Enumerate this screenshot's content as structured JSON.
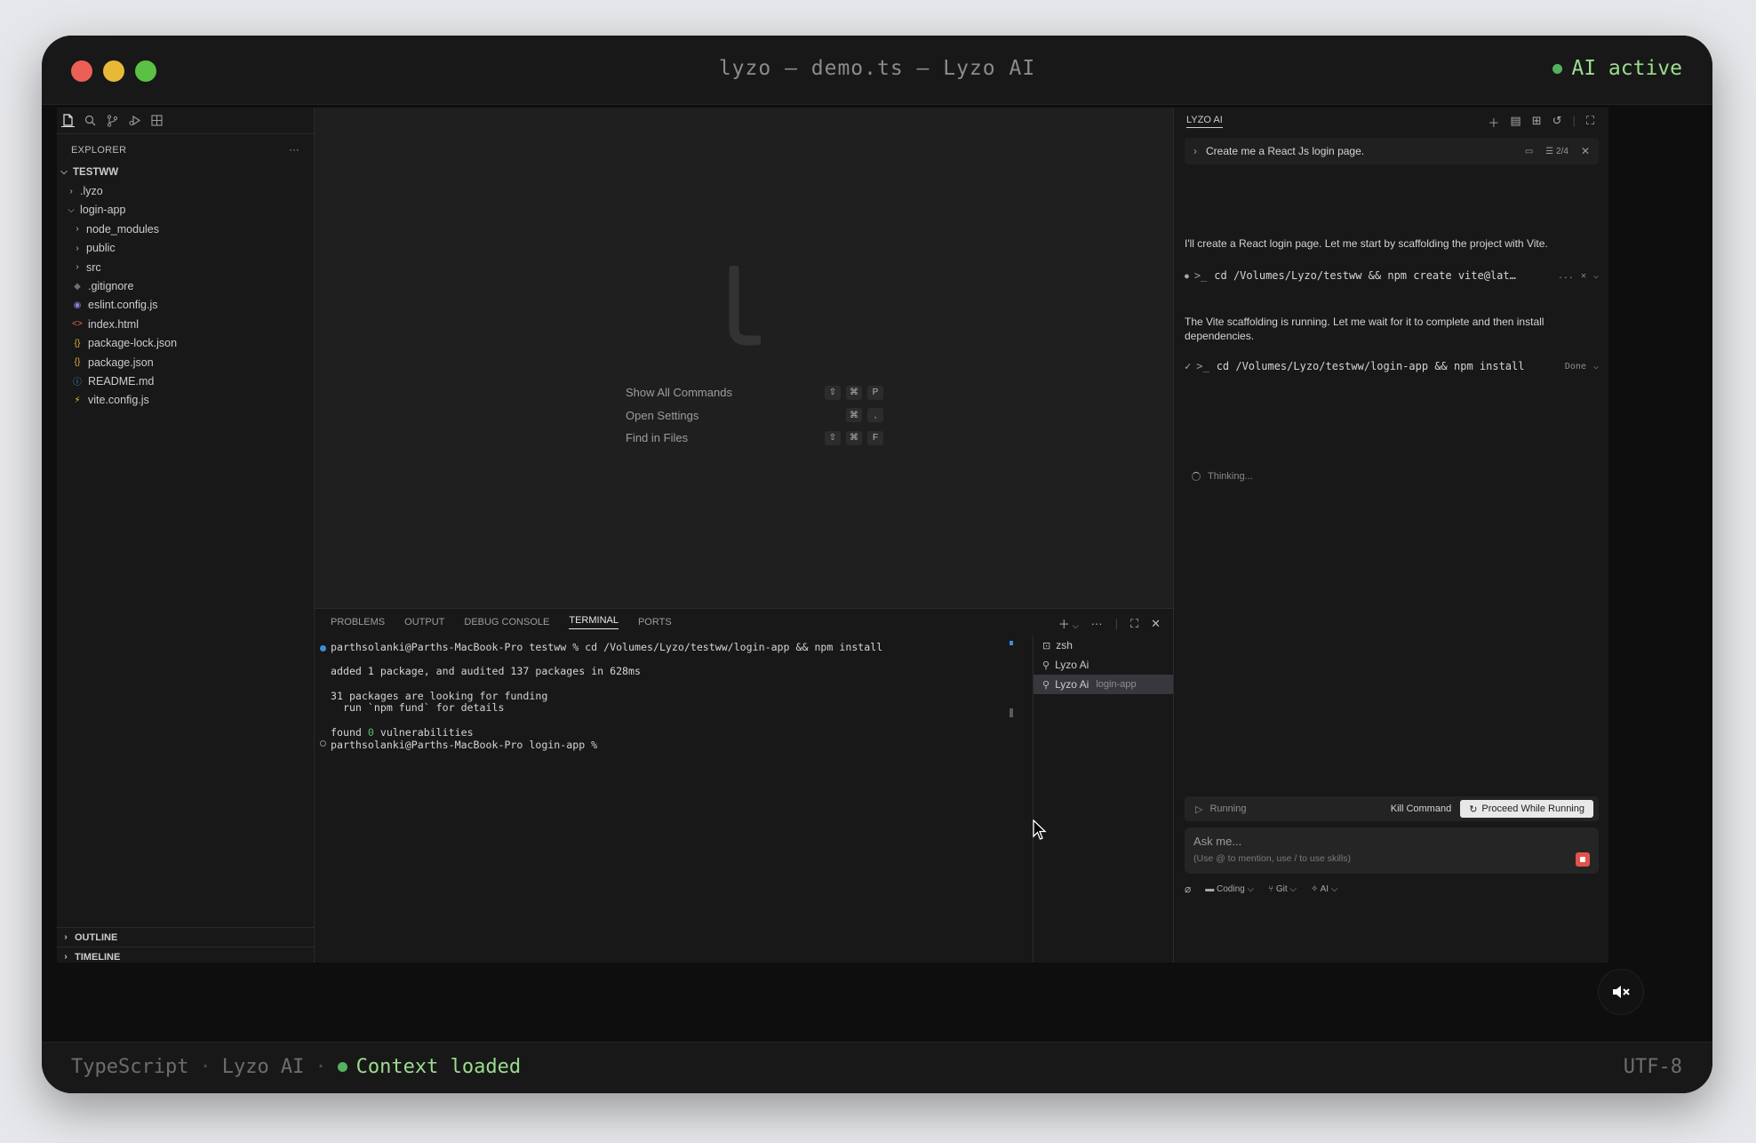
{
  "window": {
    "title": "lyzo — demo.ts — Lyzo AI",
    "ai_status": "AI active"
  },
  "status_bar": {
    "language": "TypeScript",
    "sep": "·",
    "app": "Lyzo AI",
    "context": "Context loaded",
    "encoding": "UTF-8"
  },
  "explorer": {
    "header": "EXPLORER",
    "more": "···",
    "root": "TESTWW",
    "items": [
      {
        "label": ".lyzo",
        "kind": "folder",
        "depth": 1,
        "open": false
      },
      {
        "label": "login-app",
        "kind": "folder",
        "depth": 1,
        "open": true
      },
      {
        "label": "node_modules",
        "kind": "folder",
        "depth": 2,
        "open": false
      },
      {
        "label": "public",
        "kind": "folder",
        "depth": 2,
        "open": false
      },
      {
        "label": "src",
        "kind": "folder",
        "depth": 2,
        "open": false
      },
      {
        "label": ".gitignore",
        "kind": "file",
        "depth": 2,
        "icon": "git-icon",
        "glyph": "◆",
        "color": "#6f6f6f"
      },
      {
        "label": "eslint.config.js",
        "kind": "file",
        "depth": 2,
        "icon": "eslint-icon",
        "glyph": "◉",
        "color": "#8f7ad6"
      },
      {
        "label": "index.html",
        "kind": "file",
        "depth": 2,
        "icon": "html-icon",
        "glyph": "<>",
        "color": "#e3733c"
      },
      {
        "label": "package-lock.json",
        "kind": "file",
        "depth": 2,
        "icon": "json-icon",
        "glyph": "{}",
        "color": "#d7b23d"
      },
      {
        "label": "package.json",
        "kind": "file",
        "depth": 2,
        "icon": "json-icon",
        "glyph": "{}",
        "color": "#d7b23d"
      },
      {
        "label": "README.md",
        "kind": "file",
        "depth": 2,
        "icon": "info-icon",
        "glyph": "ⓘ",
        "color": "#4d9bd6"
      },
      {
        "label": "vite.config.js",
        "kind": "file",
        "depth": 2,
        "icon": "vite-icon",
        "glyph": "⚡",
        "color": "#e7c73a"
      }
    ],
    "outline": "OUTLINE",
    "timeline": "TIMELINE"
  },
  "editor": {
    "shortcuts": [
      {
        "label": "Show All Commands",
        "keys": [
          "⇧",
          "⌘",
          "P"
        ]
      },
      {
        "label": "Open Settings",
        "keys": [
          "⌘",
          ","
        ]
      },
      {
        "label": "Find in Files",
        "keys": [
          "⇧",
          "⌘",
          "F"
        ]
      }
    ]
  },
  "panel": {
    "tabs": [
      "PROBLEMS",
      "OUTPUT",
      "DEBUG CONSOLE",
      "TERMINAL",
      "PORTS"
    ],
    "active_tab": "TERMINAL",
    "terminal": {
      "cmd_line": "parthsolanki@Parths-MacBook-Pro testww % cd /Volumes/Lyzo/testww/login-app && npm install",
      "added": "added 1 package, and audited 137 packages in 628ms",
      "funding1": "31 packages are looking for funding",
      "funding2": "  run `npm fund` for details",
      "found_pre": "found ",
      "found_num": "0",
      "found_post": " vulnerabilities",
      "prompt": "parthsolanki@Parths-MacBook-Pro login-app %"
    },
    "sessions": [
      {
        "label": "zsh",
        "sub": ""
      },
      {
        "label": "Lyzo Ai",
        "sub": ""
      },
      {
        "label": "Lyzo Ai",
        "sub": "login-app"
      }
    ]
  },
  "chat": {
    "title": "LYZO AI",
    "prompt": "Create me a React Js login page.",
    "prompt_count": "2/4",
    "msg1": "I'll create a React login page. Let me start by scaffolding the project with Vite.",
    "cmd1": "cd /Volumes/Lyzo/testww && npm create vite@lat…",
    "cmd1_more": "...",
    "msg2": "The Vite scaffolding is running. Let me wait for it to complete and then install dependencies.",
    "cmd2": "cd /Volumes/Lyzo/testww/login-app && npm install",
    "cmd2_status": "Done",
    "thinking": "Thinking...",
    "running": "Running",
    "kill": "Kill Command",
    "proceed": "Proceed While Running",
    "ask_placeholder": "Ask me...",
    "ask_hint": "(Use @ to mention, use / to use skills)",
    "footer": {
      "mode": "Coding",
      "git": "Git",
      "ai": "AI"
    }
  }
}
